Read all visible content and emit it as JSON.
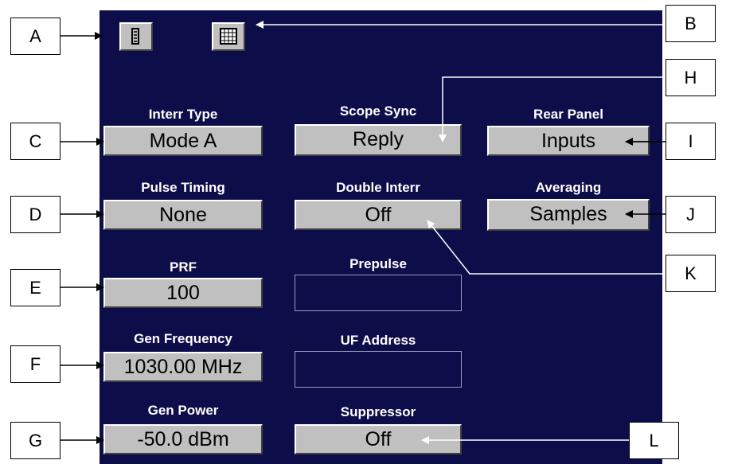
{
  "fields": {
    "interr_type": {
      "label": "Interr Type",
      "value": "Mode A"
    },
    "scope_sync": {
      "label": "Scope Sync",
      "value": "Reply"
    },
    "rear_panel": {
      "label": "Rear Panel",
      "value": "Inputs"
    },
    "pulse_timing": {
      "label": "Pulse Timing",
      "value": "None"
    },
    "double_interr": {
      "label": "Double Interr",
      "value": "Off"
    },
    "averaging": {
      "label": "Averaging",
      "value": "Samples"
    },
    "prf": {
      "label": "PRF",
      "value": "100"
    },
    "prepulse": {
      "label": "Prepulse",
      "value": ""
    },
    "gen_frequency": {
      "label": "Gen Frequency",
      "value": "1030.00 MHz"
    },
    "uf_address": {
      "label": "UF Address",
      "value": ""
    },
    "gen_power": {
      "label": "Gen Power",
      "value": "-50.0 dBm"
    },
    "suppressor": {
      "label": "Suppressor",
      "value": "Off"
    }
  },
  "toolbar": {
    "icon_a": "list-view-icon",
    "icon_b": "grid-view-icon"
  },
  "callouts": [
    "A",
    "B",
    "C",
    "D",
    "E",
    "F",
    "G",
    "H",
    "I",
    "J",
    "K",
    "L"
  ],
  "colors": {
    "panel_bg": "#0d0d4a",
    "button_face": "#c0c0c0",
    "label_text": "#ffffff"
  }
}
